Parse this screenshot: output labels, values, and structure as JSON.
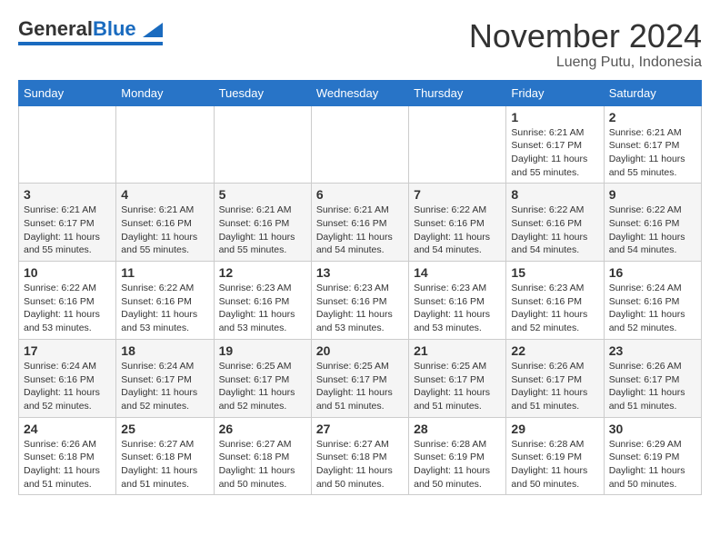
{
  "logo": {
    "general": "General",
    "blue": "Blue"
  },
  "title": "November 2024",
  "location": "Lueng Putu, Indonesia",
  "weekdays": [
    "Sunday",
    "Monday",
    "Tuesday",
    "Wednesday",
    "Thursday",
    "Friday",
    "Saturday"
  ],
  "weeks": [
    [
      {
        "day": "",
        "info": ""
      },
      {
        "day": "",
        "info": ""
      },
      {
        "day": "",
        "info": ""
      },
      {
        "day": "",
        "info": ""
      },
      {
        "day": "",
        "info": ""
      },
      {
        "day": "1",
        "info": "Sunrise: 6:21 AM\nSunset: 6:17 PM\nDaylight: 11 hours\nand 55 minutes."
      },
      {
        "day": "2",
        "info": "Sunrise: 6:21 AM\nSunset: 6:17 PM\nDaylight: 11 hours\nand 55 minutes."
      }
    ],
    [
      {
        "day": "3",
        "info": "Sunrise: 6:21 AM\nSunset: 6:17 PM\nDaylight: 11 hours\nand 55 minutes."
      },
      {
        "day": "4",
        "info": "Sunrise: 6:21 AM\nSunset: 6:16 PM\nDaylight: 11 hours\nand 55 minutes."
      },
      {
        "day": "5",
        "info": "Sunrise: 6:21 AM\nSunset: 6:16 PM\nDaylight: 11 hours\nand 55 minutes."
      },
      {
        "day": "6",
        "info": "Sunrise: 6:21 AM\nSunset: 6:16 PM\nDaylight: 11 hours\nand 54 minutes."
      },
      {
        "day": "7",
        "info": "Sunrise: 6:22 AM\nSunset: 6:16 PM\nDaylight: 11 hours\nand 54 minutes."
      },
      {
        "day": "8",
        "info": "Sunrise: 6:22 AM\nSunset: 6:16 PM\nDaylight: 11 hours\nand 54 minutes."
      },
      {
        "day": "9",
        "info": "Sunrise: 6:22 AM\nSunset: 6:16 PM\nDaylight: 11 hours\nand 54 minutes."
      }
    ],
    [
      {
        "day": "10",
        "info": "Sunrise: 6:22 AM\nSunset: 6:16 PM\nDaylight: 11 hours\nand 53 minutes."
      },
      {
        "day": "11",
        "info": "Sunrise: 6:22 AM\nSunset: 6:16 PM\nDaylight: 11 hours\nand 53 minutes."
      },
      {
        "day": "12",
        "info": "Sunrise: 6:23 AM\nSunset: 6:16 PM\nDaylight: 11 hours\nand 53 minutes."
      },
      {
        "day": "13",
        "info": "Sunrise: 6:23 AM\nSunset: 6:16 PM\nDaylight: 11 hours\nand 53 minutes."
      },
      {
        "day": "14",
        "info": "Sunrise: 6:23 AM\nSunset: 6:16 PM\nDaylight: 11 hours\nand 53 minutes."
      },
      {
        "day": "15",
        "info": "Sunrise: 6:23 AM\nSunset: 6:16 PM\nDaylight: 11 hours\nand 52 minutes."
      },
      {
        "day": "16",
        "info": "Sunrise: 6:24 AM\nSunset: 6:16 PM\nDaylight: 11 hours\nand 52 minutes."
      }
    ],
    [
      {
        "day": "17",
        "info": "Sunrise: 6:24 AM\nSunset: 6:16 PM\nDaylight: 11 hours\nand 52 minutes."
      },
      {
        "day": "18",
        "info": "Sunrise: 6:24 AM\nSunset: 6:17 PM\nDaylight: 11 hours\nand 52 minutes."
      },
      {
        "day": "19",
        "info": "Sunrise: 6:25 AM\nSunset: 6:17 PM\nDaylight: 11 hours\nand 52 minutes."
      },
      {
        "day": "20",
        "info": "Sunrise: 6:25 AM\nSunset: 6:17 PM\nDaylight: 11 hours\nand 51 minutes."
      },
      {
        "day": "21",
        "info": "Sunrise: 6:25 AM\nSunset: 6:17 PM\nDaylight: 11 hours\nand 51 minutes."
      },
      {
        "day": "22",
        "info": "Sunrise: 6:26 AM\nSunset: 6:17 PM\nDaylight: 11 hours\nand 51 minutes."
      },
      {
        "day": "23",
        "info": "Sunrise: 6:26 AM\nSunset: 6:17 PM\nDaylight: 11 hours\nand 51 minutes."
      }
    ],
    [
      {
        "day": "24",
        "info": "Sunrise: 6:26 AM\nSunset: 6:18 PM\nDaylight: 11 hours\nand 51 minutes."
      },
      {
        "day": "25",
        "info": "Sunrise: 6:27 AM\nSunset: 6:18 PM\nDaylight: 11 hours\nand 51 minutes."
      },
      {
        "day": "26",
        "info": "Sunrise: 6:27 AM\nSunset: 6:18 PM\nDaylight: 11 hours\nand 50 minutes."
      },
      {
        "day": "27",
        "info": "Sunrise: 6:27 AM\nSunset: 6:18 PM\nDaylight: 11 hours\nand 50 minutes."
      },
      {
        "day": "28",
        "info": "Sunrise: 6:28 AM\nSunset: 6:19 PM\nDaylight: 11 hours\nand 50 minutes."
      },
      {
        "day": "29",
        "info": "Sunrise: 6:28 AM\nSunset: 6:19 PM\nDaylight: 11 hours\nand 50 minutes."
      },
      {
        "day": "30",
        "info": "Sunrise: 6:29 AM\nSunset: 6:19 PM\nDaylight: 11 hours\nand 50 minutes."
      }
    ]
  ]
}
